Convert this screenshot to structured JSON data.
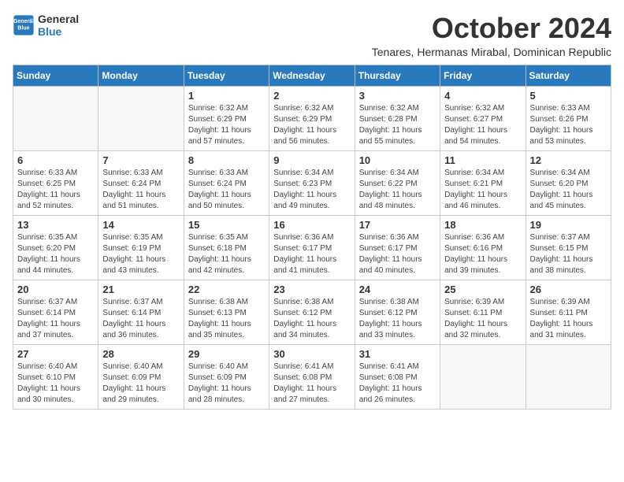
{
  "logo": {
    "line1": "General",
    "line2": "Blue"
  },
  "title": "October 2024",
  "location": "Tenares, Hermanas Mirabal, Dominican Republic",
  "weekdays": [
    "Sunday",
    "Monday",
    "Tuesday",
    "Wednesday",
    "Thursday",
    "Friday",
    "Saturday"
  ],
  "weeks": [
    [
      {
        "day": "",
        "info": ""
      },
      {
        "day": "",
        "info": ""
      },
      {
        "day": "1",
        "info": "Sunrise: 6:32 AM\nSunset: 6:29 PM\nDaylight: 11 hours\nand 57 minutes."
      },
      {
        "day": "2",
        "info": "Sunrise: 6:32 AM\nSunset: 6:29 PM\nDaylight: 11 hours\nand 56 minutes."
      },
      {
        "day": "3",
        "info": "Sunrise: 6:32 AM\nSunset: 6:28 PM\nDaylight: 11 hours\nand 55 minutes."
      },
      {
        "day": "4",
        "info": "Sunrise: 6:32 AM\nSunset: 6:27 PM\nDaylight: 11 hours\nand 54 minutes."
      },
      {
        "day": "5",
        "info": "Sunrise: 6:33 AM\nSunset: 6:26 PM\nDaylight: 11 hours\nand 53 minutes."
      }
    ],
    [
      {
        "day": "6",
        "info": "Sunrise: 6:33 AM\nSunset: 6:25 PM\nDaylight: 11 hours\nand 52 minutes."
      },
      {
        "day": "7",
        "info": "Sunrise: 6:33 AM\nSunset: 6:24 PM\nDaylight: 11 hours\nand 51 minutes."
      },
      {
        "day": "8",
        "info": "Sunrise: 6:33 AM\nSunset: 6:24 PM\nDaylight: 11 hours\nand 50 minutes."
      },
      {
        "day": "9",
        "info": "Sunrise: 6:34 AM\nSunset: 6:23 PM\nDaylight: 11 hours\nand 49 minutes."
      },
      {
        "day": "10",
        "info": "Sunrise: 6:34 AM\nSunset: 6:22 PM\nDaylight: 11 hours\nand 48 minutes."
      },
      {
        "day": "11",
        "info": "Sunrise: 6:34 AM\nSunset: 6:21 PM\nDaylight: 11 hours\nand 46 minutes."
      },
      {
        "day": "12",
        "info": "Sunrise: 6:34 AM\nSunset: 6:20 PM\nDaylight: 11 hours\nand 45 minutes."
      }
    ],
    [
      {
        "day": "13",
        "info": "Sunrise: 6:35 AM\nSunset: 6:20 PM\nDaylight: 11 hours\nand 44 minutes."
      },
      {
        "day": "14",
        "info": "Sunrise: 6:35 AM\nSunset: 6:19 PM\nDaylight: 11 hours\nand 43 minutes."
      },
      {
        "day": "15",
        "info": "Sunrise: 6:35 AM\nSunset: 6:18 PM\nDaylight: 11 hours\nand 42 minutes."
      },
      {
        "day": "16",
        "info": "Sunrise: 6:36 AM\nSunset: 6:17 PM\nDaylight: 11 hours\nand 41 minutes."
      },
      {
        "day": "17",
        "info": "Sunrise: 6:36 AM\nSunset: 6:17 PM\nDaylight: 11 hours\nand 40 minutes."
      },
      {
        "day": "18",
        "info": "Sunrise: 6:36 AM\nSunset: 6:16 PM\nDaylight: 11 hours\nand 39 minutes."
      },
      {
        "day": "19",
        "info": "Sunrise: 6:37 AM\nSunset: 6:15 PM\nDaylight: 11 hours\nand 38 minutes."
      }
    ],
    [
      {
        "day": "20",
        "info": "Sunrise: 6:37 AM\nSunset: 6:14 PM\nDaylight: 11 hours\nand 37 minutes."
      },
      {
        "day": "21",
        "info": "Sunrise: 6:37 AM\nSunset: 6:14 PM\nDaylight: 11 hours\nand 36 minutes."
      },
      {
        "day": "22",
        "info": "Sunrise: 6:38 AM\nSunset: 6:13 PM\nDaylight: 11 hours\nand 35 minutes."
      },
      {
        "day": "23",
        "info": "Sunrise: 6:38 AM\nSunset: 6:12 PM\nDaylight: 11 hours\nand 34 minutes."
      },
      {
        "day": "24",
        "info": "Sunrise: 6:38 AM\nSunset: 6:12 PM\nDaylight: 11 hours\nand 33 minutes."
      },
      {
        "day": "25",
        "info": "Sunrise: 6:39 AM\nSunset: 6:11 PM\nDaylight: 11 hours\nand 32 minutes."
      },
      {
        "day": "26",
        "info": "Sunrise: 6:39 AM\nSunset: 6:11 PM\nDaylight: 11 hours\nand 31 minutes."
      }
    ],
    [
      {
        "day": "27",
        "info": "Sunrise: 6:40 AM\nSunset: 6:10 PM\nDaylight: 11 hours\nand 30 minutes."
      },
      {
        "day": "28",
        "info": "Sunrise: 6:40 AM\nSunset: 6:09 PM\nDaylight: 11 hours\nand 29 minutes."
      },
      {
        "day": "29",
        "info": "Sunrise: 6:40 AM\nSunset: 6:09 PM\nDaylight: 11 hours\nand 28 minutes."
      },
      {
        "day": "30",
        "info": "Sunrise: 6:41 AM\nSunset: 6:08 PM\nDaylight: 11 hours\nand 27 minutes."
      },
      {
        "day": "31",
        "info": "Sunrise: 6:41 AM\nSunset: 6:08 PM\nDaylight: 11 hours\nand 26 minutes."
      },
      {
        "day": "",
        "info": ""
      },
      {
        "day": "",
        "info": ""
      }
    ]
  ]
}
